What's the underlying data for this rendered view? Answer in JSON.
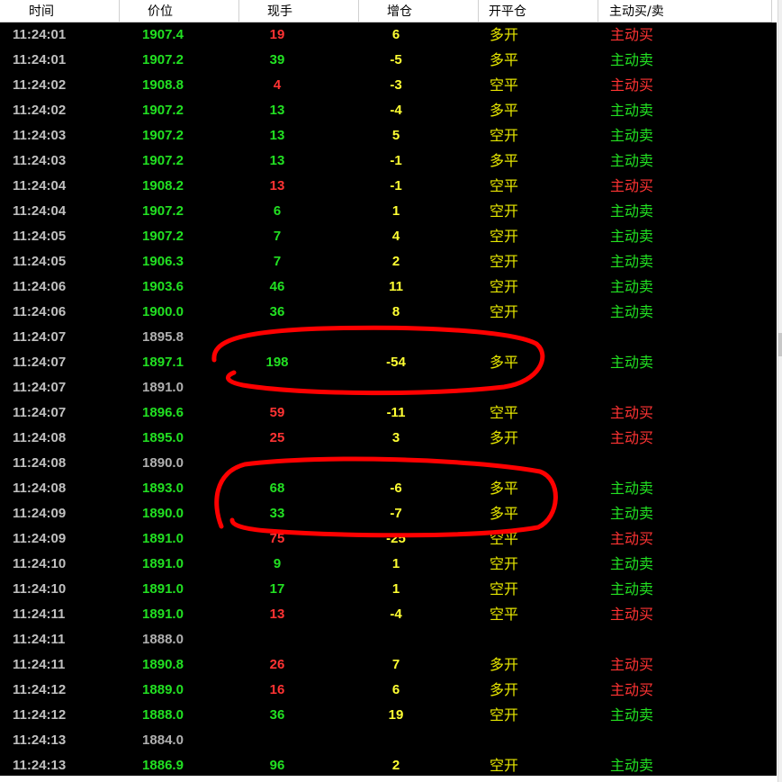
{
  "header": {
    "columns": [
      "时间",
      "价位",
      "现手",
      "增仓",
      "开平仓",
      "主动买/卖"
    ]
  },
  "colors": {
    "up": "#ff3333",
    "down": "#22e022",
    "neutral": "#b0b0b0",
    "type_text": "#e6e600",
    "background": "#000000",
    "annotation": "#ff0000"
  },
  "rows": [
    {
      "time": "11:24:01",
      "price": "1907.4",
      "vol": "19",
      "oi": "6",
      "type": "多开",
      "dir": "主动买",
      "price_c": "green",
      "vol_c": "red",
      "dir_c": "red"
    },
    {
      "time": "11:24:01",
      "price": "1907.2",
      "vol": "39",
      "oi": "-5",
      "type": "多平",
      "dir": "主动卖",
      "price_c": "green",
      "vol_c": "green",
      "dir_c": "green"
    },
    {
      "time": "11:24:02",
      "price": "1908.8",
      "vol": "4",
      "oi": "-3",
      "type": "空平",
      "dir": "主动买",
      "price_c": "green",
      "vol_c": "red",
      "dir_c": "red"
    },
    {
      "time": "11:24:02",
      "price": "1907.2",
      "vol": "13",
      "oi": "-4",
      "type": "多平",
      "dir": "主动卖",
      "price_c": "green",
      "vol_c": "green",
      "dir_c": "green"
    },
    {
      "time": "11:24:03",
      "price": "1907.2",
      "vol": "13",
      "oi": "5",
      "type": "空开",
      "dir": "主动卖",
      "price_c": "green",
      "vol_c": "green",
      "dir_c": "green"
    },
    {
      "time": "11:24:03",
      "price": "1907.2",
      "vol": "13",
      "oi": "-1",
      "type": "多平",
      "dir": "主动卖",
      "price_c": "green",
      "vol_c": "green",
      "dir_c": "green"
    },
    {
      "time": "11:24:04",
      "price": "1908.2",
      "vol": "13",
      "oi": "-1",
      "type": "空平",
      "dir": "主动买",
      "price_c": "green",
      "vol_c": "red",
      "dir_c": "red"
    },
    {
      "time": "11:24:04",
      "price": "1907.2",
      "vol": "6",
      "oi": "1",
      "type": "空开",
      "dir": "主动卖",
      "price_c": "green",
      "vol_c": "green",
      "dir_c": "green"
    },
    {
      "time": "11:24:05",
      "price": "1907.2",
      "vol": "7",
      "oi": "4",
      "type": "空开",
      "dir": "主动卖",
      "price_c": "green",
      "vol_c": "green",
      "dir_c": "green"
    },
    {
      "time": "11:24:05",
      "price": "1906.3",
      "vol": "7",
      "oi": "2",
      "type": "空开",
      "dir": "主动卖",
      "price_c": "green",
      "vol_c": "green",
      "dir_c": "green"
    },
    {
      "time": "11:24:06",
      "price": "1903.6",
      "vol": "46",
      "oi": "11",
      "type": "空开",
      "dir": "主动卖",
      "price_c": "green",
      "vol_c": "green",
      "dir_c": "green"
    },
    {
      "time": "11:24:06",
      "price": "1900.0",
      "vol": "36",
      "oi": "8",
      "type": "空开",
      "dir": "主动卖",
      "price_c": "green",
      "vol_c": "green",
      "dir_c": "green"
    },
    {
      "time": "11:24:07",
      "price": "1895.8",
      "vol": "",
      "oi": "",
      "type": "",
      "dir": "",
      "price_c": "gray",
      "vol_c": "gray",
      "dir_c": "gray"
    },
    {
      "time": "11:24:07",
      "price": "1897.1",
      "vol": "198",
      "oi": "-54",
      "type": "多平",
      "dir": "主动卖",
      "price_c": "green",
      "vol_c": "green",
      "dir_c": "green"
    },
    {
      "time": "11:24:07",
      "price": "1891.0",
      "vol": "",
      "oi": "",
      "type": "",
      "dir": "",
      "price_c": "gray",
      "vol_c": "gray",
      "dir_c": "gray"
    },
    {
      "time": "11:24:07",
      "price": "1896.6",
      "vol": "59",
      "oi": "-11",
      "type": "空平",
      "dir": "主动买",
      "price_c": "green",
      "vol_c": "red",
      "dir_c": "red"
    },
    {
      "time": "11:24:08",
      "price": "1895.0",
      "vol": "25",
      "oi": "3",
      "type": "多开",
      "dir": "主动买",
      "price_c": "green",
      "vol_c": "red",
      "dir_c": "red"
    },
    {
      "time": "11:24:08",
      "price": "1890.0",
      "vol": "",
      "oi": "",
      "type": "",
      "dir": "",
      "price_c": "gray",
      "vol_c": "gray",
      "dir_c": "gray"
    },
    {
      "time": "11:24:08",
      "price": "1893.0",
      "vol": "68",
      "oi": "-6",
      "type": "多平",
      "dir": "主动卖",
      "price_c": "green",
      "vol_c": "green",
      "dir_c": "green"
    },
    {
      "time": "11:24:09",
      "price": "1890.0",
      "vol": "33",
      "oi": "-7",
      "type": "多平",
      "dir": "主动卖",
      "price_c": "green",
      "vol_c": "green",
      "dir_c": "green"
    },
    {
      "time": "11:24:09",
      "price": "1891.0",
      "vol": "75",
      "oi": "-25",
      "type": "空平",
      "dir": "主动买",
      "price_c": "green",
      "vol_c": "red",
      "dir_c": "red"
    },
    {
      "time": "11:24:10",
      "price": "1891.0",
      "vol": "9",
      "oi": "1",
      "type": "空开",
      "dir": "主动卖",
      "price_c": "green",
      "vol_c": "green",
      "dir_c": "green"
    },
    {
      "time": "11:24:10",
      "price": "1891.0",
      "vol": "17",
      "oi": "1",
      "type": "空开",
      "dir": "主动卖",
      "price_c": "green",
      "vol_c": "green",
      "dir_c": "green"
    },
    {
      "time": "11:24:11",
      "price": "1891.0",
      "vol": "13",
      "oi": "-4",
      "type": "空平",
      "dir": "主动买",
      "price_c": "green",
      "vol_c": "red",
      "dir_c": "red"
    },
    {
      "time": "11:24:11",
      "price": "1888.0",
      "vol": "",
      "oi": "",
      "type": "",
      "dir": "",
      "price_c": "gray",
      "vol_c": "gray",
      "dir_c": "gray"
    },
    {
      "time": "11:24:11",
      "price": "1890.8",
      "vol": "26",
      "oi": "7",
      "type": "多开",
      "dir": "主动买",
      "price_c": "green",
      "vol_c": "red",
      "dir_c": "red"
    },
    {
      "time": "11:24:12",
      "price": "1889.0",
      "vol": "16",
      "oi": "6",
      "type": "多开",
      "dir": "主动买",
      "price_c": "green",
      "vol_c": "red",
      "dir_c": "red"
    },
    {
      "time": "11:24:12",
      "price": "1888.0",
      "vol": "36",
      "oi": "19",
      "type": "空开",
      "dir": "主动卖",
      "price_c": "green",
      "vol_c": "green",
      "dir_c": "green"
    },
    {
      "time": "11:24:13",
      "price": "1884.0",
      "vol": "",
      "oi": "",
      "type": "",
      "dir": "",
      "price_c": "gray",
      "vol_c": "gray",
      "dir_c": "gray"
    },
    {
      "time": "11:24:13",
      "price": "1886.9",
      "vol": "96",
      "oi": "2",
      "type": "空开",
      "dir": "主动卖",
      "price_c": "green",
      "vol_c": "green",
      "dir_c": "green"
    }
  ]
}
